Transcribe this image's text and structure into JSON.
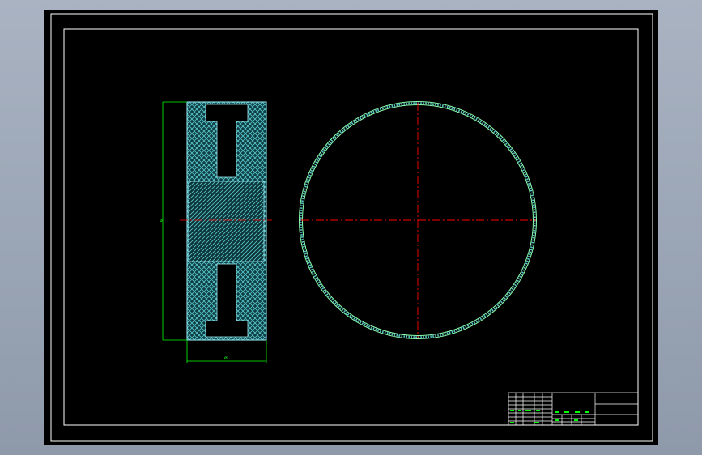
{
  "drawing": {
    "background_color": "#000000",
    "frame_color": "#ffffff",
    "section_fill_color": "#55c6c8",
    "dimension_color": "#00ff00",
    "centerline_color": "#ff0000",
    "circle_color": "#8cffb0"
  },
  "dimensions": {
    "height_label": "ø",
    "width_label": "ø"
  },
  "title_block": {
    "color": "#ffffff",
    "text_color": "#00ff00"
  }
}
